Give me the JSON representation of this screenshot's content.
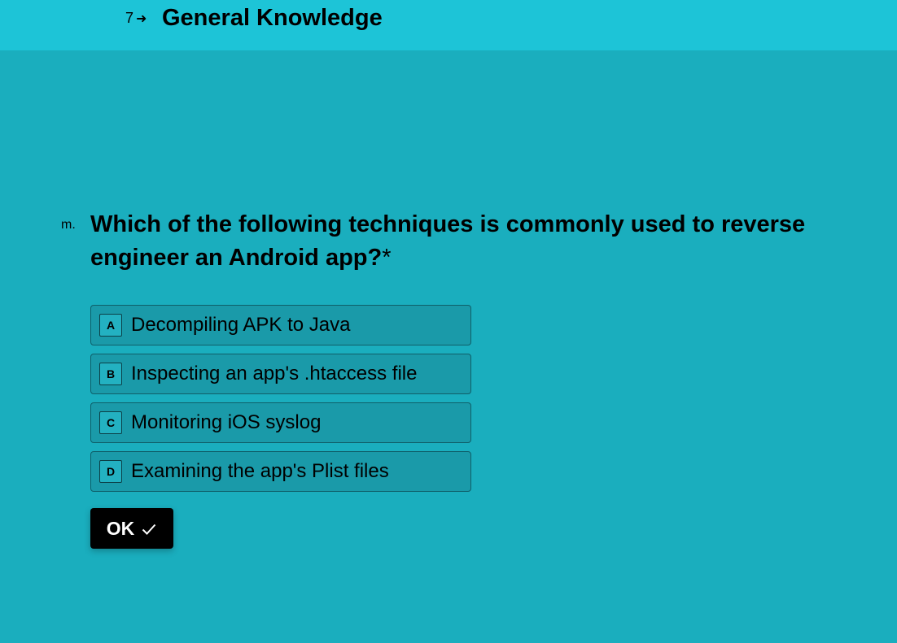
{
  "previous_question": {
    "number": "7",
    "arrow_icon": "arrow-right-icon",
    "title": "General Knowledge"
  },
  "question": {
    "prefix": "m.",
    "text": "Which of the following techniques is commonly used to reverse engineer an Android app?",
    "required_marker": "*"
  },
  "choices": [
    {
      "key": "A",
      "label": "Decompiling APK to Java"
    },
    {
      "key": "B",
      "label": "Inspecting an app's .htaccess file"
    },
    {
      "key": "C",
      "label": "Monitoring iOS syslog"
    },
    {
      "key": "D",
      "label": "Examining the app's Plist files"
    }
  ],
  "ok_button": {
    "label": "OK",
    "icon": "checkmark-icon"
  },
  "colors": {
    "background": "#1aaebe",
    "banner": "#1dc4d7",
    "choice_fill": "#1a9aa9",
    "button": "#000000"
  }
}
